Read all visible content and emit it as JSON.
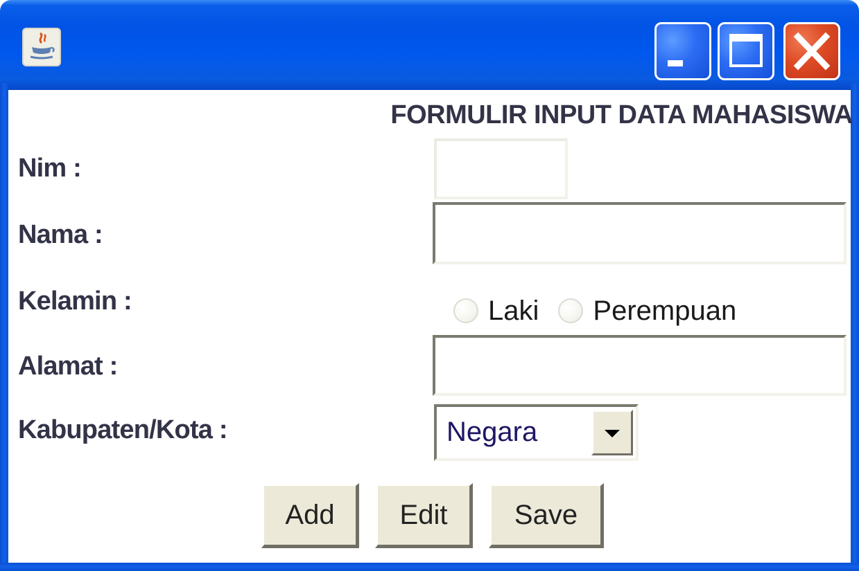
{
  "window": {
    "controls": {
      "minimize_icon": "minimize-icon",
      "maximize_icon": "maximize-icon",
      "close_icon": "close-icon"
    },
    "app_icon": "java-cup-icon",
    "title_bar_color": "#0058ee",
    "close_button_color": "#dd4a24"
  },
  "form": {
    "title": "FORMULIR INPUT DATA MAHASISWA",
    "labels": {
      "nim": "Nim :",
      "nama": "Nama :",
      "kelamin": "Kelamin :",
      "alamat": "Alamat :",
      "kabupaten": "Kabupaten/Kota :"
    },
    "fields": {
      "nim_value": "",
      "nama_value": "",
      "alamat_value": ""
    },
    "gender_options": [
      "Laki",
      "Perempuan"
    ],
    "kabupaten_selected": "Negara",
    "buttons": {
      "add": "Add",
      "edit": "Edit",
      "save": "Save"
    }
  }
}
